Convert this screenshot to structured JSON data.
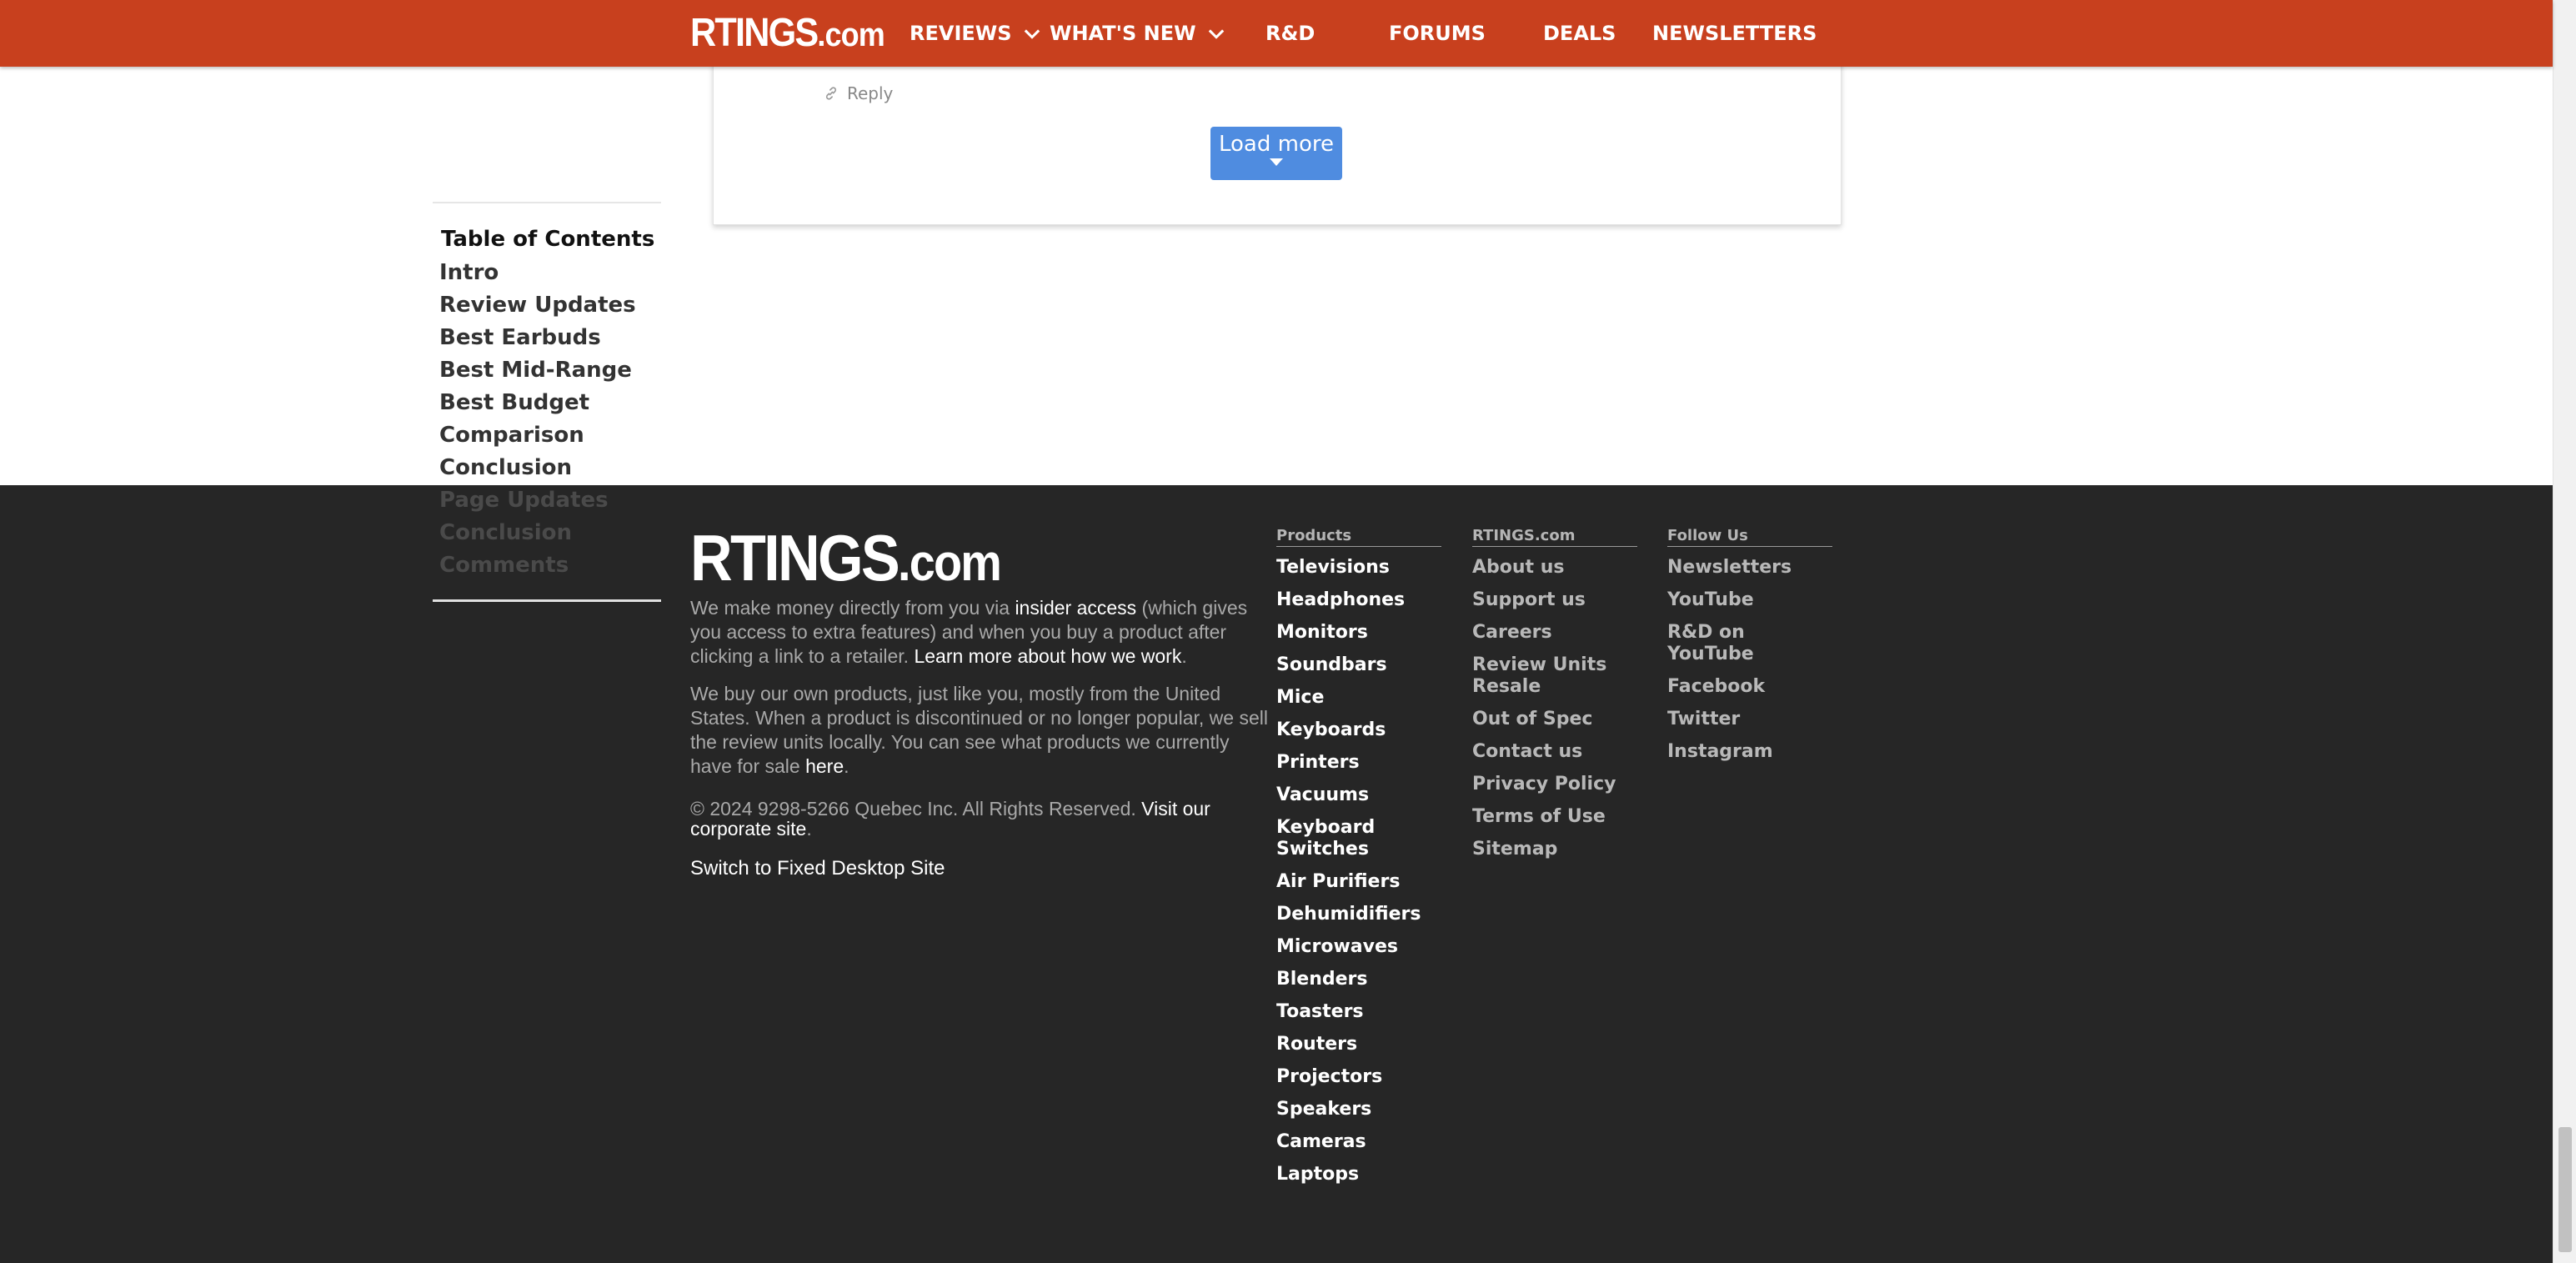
{
  "nav": {
    "logo_main": "RTINGS",
    "logo_suffix": ".com",
    "items": [
      {
        "label": "REVIEWS"
      },
      {
        "label": "WHAT'S NEW"
      },
      {
        "label": "R&D"
      },
      {
        "label": "FORUMS"
      },
      {
        "label": "DEALS"
      },
      {
        "label": "NEWSLETTERS"
      }
    ],
    "icons": [
      "chevron-down-icon",
      "chevron-down-icon"
    ]
  },
  "toc": {
    "heading": "Table of Contents",
    "items": [
      "Intro",
      "Review Updates",
      "Best Earbuds",
      "Best Mid-Range",
      "Best Budget",
      "Comparison",
      "Conclusion",
      "Page Updates",
      "Conclusion",
      "Comments"
    ]
  },
  "comments": {
    "reply_label": "Reply",
    "reply_icon": "link-icon",
    "load_more_label": "Load more"
  },
  "footer": {
    "logo_main": "RTINGS",
    "logo_suffix": ".com",
    "para1": {
      "t1": "We make money directly from you via ",
      "link1": "insider access",
      "t2": " (which gives you access to extra features) and when you buy a product after clicking a link to a retailer. ",
      "link2": "Learn more about how we work",
      "t3": "."
    },
    "para2": {
      "t1": "We buy our own products, just like you, mostly from the United States. When a product is discontinued or no longer popular, we sell the review units locally. You can see what products we currently have for sale ",
      "link1": "here",
      "t2": "."
    },
    "para3": {
      "t1": "© 2024 9298-5266 Quebec Inc. All Rights Reserved. ",
      "link1": "Visit our corporate site",
      "t2": "."
    },
    "switch_label": "Switch to Fixed Desktop Site",
    "products": {
      "heading": "Products",
      "items": [
        "Televisions",
        "Headphones",
        "Monitors",
        "Soundbars",
        "Mice",
        "Keyboards",
        "Printers",
        "Vacuums",
        "Keyboard Switches",
        "Air Purifiers",
        "Dehumidifiers",
        "Microwaves",
        "Blenders",
        "Toasters",
        "Routers",
        "Projectors",
        "Speakers",
        "Cameras",
        "Laptops"
      ]
    },
    "company": {
      "heading": "RTINGS.com",
      "items": [
        "About us",
        "Support us",
        "Careers",
        "Review Units Resale",
        "Out of Spec",
        "Contact us",
        "Privacy Policy",
        "Terms of Use",
        "Sitemap"
      ]
    },
    "follow": {
      "heading": "Follow Us",
      "items": [
        "Newsletters",
        "YouTube",
        "R&D on YouTube",
        "Facebook",
        "Twitter",
        "Instagram"
      ]
    }
  },
  "colors": {
    "nav_bg": "#c8401e",
    "footer_bg": "#262626",
    "load_more_bg": "#4f8ce0"
  }
}
